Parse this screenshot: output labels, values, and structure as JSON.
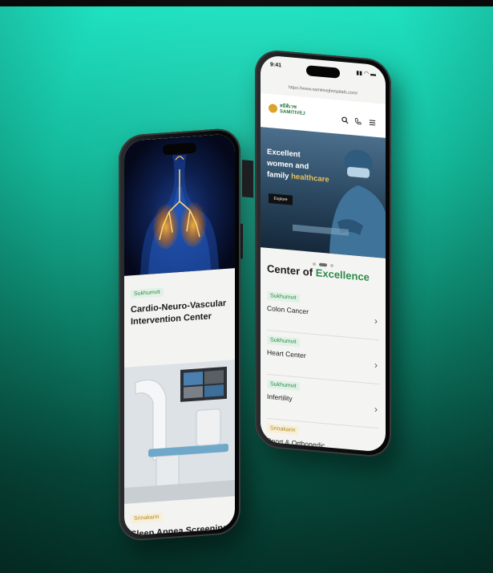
{
  "left_phone": {
    "cards": [
      {
        "tag": "Sukhumvit",
        "title": "Cardio-Neuro-Vascular Intervention Center",
        "tag_color": "green"
      },
      {
        "tag": "Srinakarin",
        "title": "Sleep Apnea Screening",
        "tag_color": "gold"
      }
    ]
  },
  "right_phone": {
    "status": {
      "time": "9:41",
      "icons": "▮▮ ◠ ▬"
    },
    "url": "https://www.samitivejhospitals.com/",
    "logo": {
      "line1": "สมิติเวช",
      "line2": "SAMITIVEJ"
    },
    "header_icons": [
      "search-icon",
      "phone-icon",
      "menu-icon"
    ],
    "hero": {
      "line1": "Excellent",
      "line2": "women and",
      "line3_plain": "family",
      "line3_highlight": "healthcare",
      "button": "Explore"
    },
    "section_title_plain": "Center of",
    "section_title_accent": "Excellence",
    "coe_items": [
      {
        "tag": "Sukhumvit",
        "name": "Colon Cancer",
        "tag_color": "green"
      },
      {
        "tag": "Sukhumvit",
        "name": "Heart Center",
        "tag_color": "green"
      },
      {
        "tag": "Sukhumvit",
        "name": "Infertility",
        "tag_color": "green"
      },
      {
        "tag": "Srinakarin",
        "name": "Sport & Orthopedic",
        "tag_color": "gold"
      }
    ]
  },
  "colors": {
    "brand_green": "#2e8a4b",
    "brand_gold": "#d9a52b",
    "bg_top": "#1fe3c2",
    "bg_bottom": "#05362c"
  }
}
